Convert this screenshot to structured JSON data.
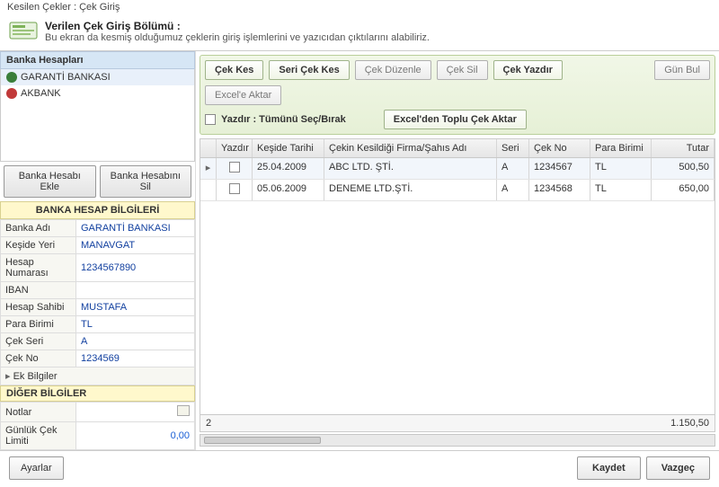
{
  "window_title": "Kesilen Çekler : Çek Giriş",
  "header": {
    "title": "Verilen Çek Giriş Bölümü :",
    "subtitle": "Bu ekran da kesmiş olduğumuz çeklerin giriş işlemlerini ve yazıcıdan çıktılarını alabiliriz."
  },
  "sidebar": {
    "section_title": "Banka Hesapları",
    "banks": [
      {
        "name": "GARANTİ BANKASI",
        "color": "#d44"
      },
      {
        "name": "AKBANK",
        "color": "#c33"
      }
    ],
    "add_btn": "Banka Hesabı Ekle",
    "del_btn": "Banka Hesabını Sil",
    "info_head": "BANKA HESAP BİLGİLERİ",
    "info": {
      "banka_adi_k": "Banka Adı",
      "banka_adi_v": "GARANTİ BANKASI",
      "keside_k": "Keşide Yeri",
      "keside_v": "MANAVGAT",
      "hesap_no_k": "Hesap Numarası",
      "hesap_no_v": "1234567890",
      "iban_k": "IBAN",
      "iban_v": "",
      "sahip_k": "Hesap Sahibi",
      "sahip_v": "MUSTAFA",
      "birim_k": "Para Birimi",
      "birim_v": "TL",
      "seri_k": "Çek Seri",
      "seri_v": "A",
      "cekno_k": "Çek No",
      "cekno_v": "1234569",
      "ek_k": "Ek Bilgiler"
    },
    "other_head": "DİĞER BİLGİLER",
    "other": {
      "notlar_k": "Notlar",
      "limit_k": "Günlük Çek Limiti",
      "limit_v": "0,00"
    }
  },
  "toolbar": {
    "cek_kes": "Çek Kes",
    "seri_cek": "Seri Çek Kes",
    "duzenle": "Çek Düzenle",
    "sil": "Çek Sil",
    "yazdir": "Çek Yazdır",
    "gun_bul": "Gün Bul",
    "excel_aktar": "Excel'e Aktar",
    "tumu_sec": "Yazdır : Tümünü Seç/Bırak",
    "toplu_aktar": "Excel'den Toplu Çek Aktar"
  },
  "grid": {
    "headers": {
      "yazdir": "Yazdır",
      "keside_tarihi": "Keşide Tarihi",
      "firma": "Çekin Kesildiği Firma/Şahıs Adı",
      "seri": "Seri",
      "cekno": "Çek No",
      "birim": "Para Birimi",
      "tutar": "Tutar"
    },
    "rows": [
      {
        "date": "25.04.2009",
        "firm": "ABC LTD. ŞTİ.",
        "seri": "A",
        "no": "1234567",
        "cur": "TL",
        "amt": "500,50"
      },
      {
        "date": "05.06.2009",
        "firm": "DENEME LTD.ŞTİ.",
        "seri": "A",
        "no": "1234568",
        "cur": "TL",
        "amt": "650,00"
      }
    ],
    "footer": {
      "count": "2",
      "total": "1.150,50"
    }
  },
  "footer": {
    "ayarlar": "Ayarlar",
    "kaydet": "Kaydet",
    "vazgec": "Vazgeç"
  }
}
